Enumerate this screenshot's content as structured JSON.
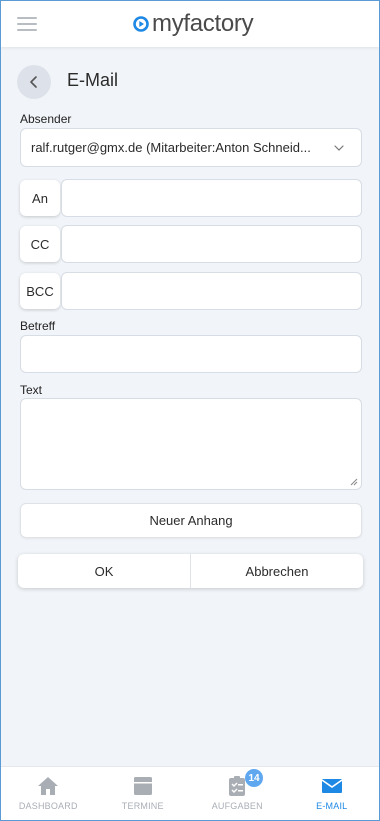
{
  "header": {
    "logo_text": "myfactory",
    "brand_color": "#1e88e5"
  },
  "page": {
    "title": "E-Mail"
  },
  "form": {
    "sender_label": "Absender",
    "sender_value": "ralf.rutger@gmx.de (Mitarbeiter:Anton Schneid...",
    "to_label": "An",
    "cc_label": "CC",
    "bcc_label": "BCC",
    "subject_label": "Betreff",
    "text_label": "Text"
  },
  "actions": {
    "attachment_label": "Neuer Anhang",
    "ok_label": "OK",
    "cancel_label": "Abbrechen"
  },
  "bottom_nav": {
    "items": [
      {
        "label": "DASHBOARD",
        "icon": "home-icon"
      },
      {
        "label": "TERMINE",
        "icon": "calendar-icon"
      },
      {
        "label": "AUFGABEN",
        "icon": "tasks-icon",
        "badge": "14"
      },
      {
        "label": "E-MAIL",
        "icon": "mail-icon",
        "active": true
      }
    ]
  }
}
